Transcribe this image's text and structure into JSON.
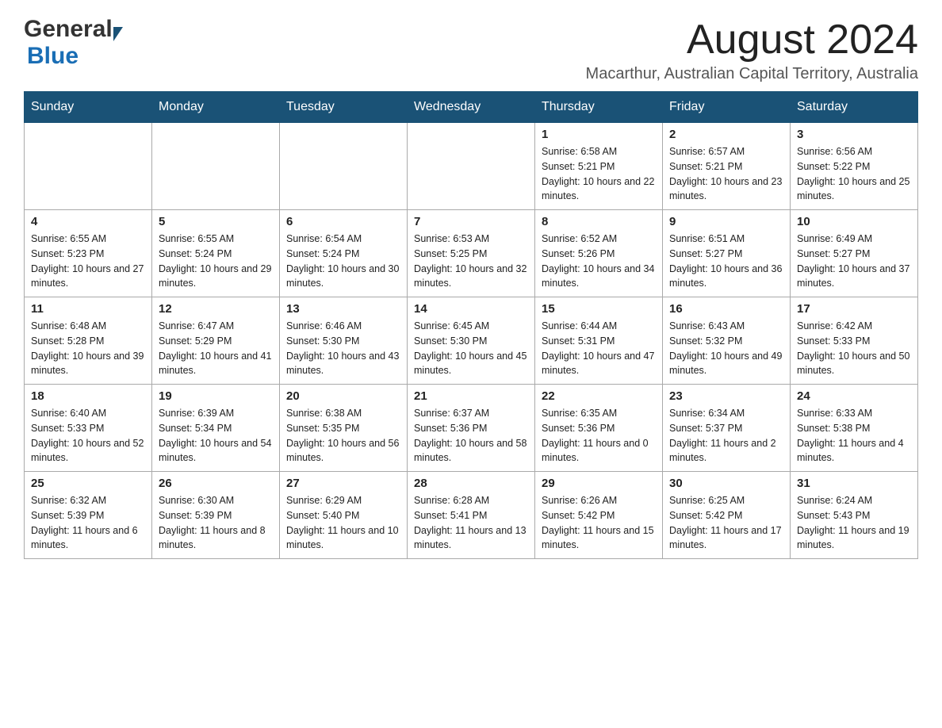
{
  "logo": {
    "general": "General",
    "blue": "Blue"
  },
  "title": "August 2024",
  "subtitle": "Macarthur, Australian Capital Territory, Australia",
  "headers": [
    "Sunday",
    "Monday",
    "Tuesday",
    "Wednesday",
    "Thursday",
    "Friday",
    "Saturday"
  ],
  "weeks": [
    [
      {
        "day": "",
        "info": ""
      },
      {
        "day": "",
        "info": ""
      },
      {
        "day": "",
        "info": ""
      },
      {
        "day": "",
        "info": ""
      },
      {
        "day": "1",
        "info": "Sunrise: 6:58 AM\nSunset: 5:21 PM\nDaylight: 10 hours and 22 minutes."
      },
      {
        "day": "2",
        "info": "Sunrise: 6:57 AM\nSunset: 5:21 PM\nDaylight: 10 hours and 23 minutes."
      },
      {
        "day": "3",
        "info": "Sunrise: 6:56 AM\nSunset: 5:22 PM\nDaylight: 10 hours and 25 minutes."
      }
    ],
    [
      {
        "day": "4",
        "info": "Sunrise: 6:55 AM\nSunset: 5:23 PM\nDaylight: 10 hours and 27 minutes."
      },
      {
        "day": "5",
        "info": "Sunrise: 6:55 AM\nSunset: 5:24 PM\nDaylight: 10 hours and 29 minutes."
      },
      {
        "day": "6",
        "info": "Sunrise: 6:54 AM\nSunset: 5:24 PM\nDaylight: 10 hours and 30 minutes."
      },
      {
        "day": "7",
        "info": "Sunrise: 6:53 AM\nSunset: 5:25 PM\nDaylight: 10 hours and 32 minutes."
      },
      {
        "day": "8",
        "info": "Sunrise: 6:52 AM\nSunset: 5:26 PM\nDaylight: 10 hours and 34 minutes."
      },
      {
        "day": "9",
        "info": "Sunrise: 6:51 AM\nSunset: 5:27 PM\nDaylight: 10 hours and 36 minutes."
      },
      {
        "day": "10",
        "info": "Sunrise: 6:49 AM\nSunset: 5:27 PM\nDaylight: 10 hours and 37 minutes."
      }
    ],
    [
      {
        "day": "11",
        "info": "Sunrise: 6:48 AM\nSunset: 5:28 PM\nDaylight: 10 hours and 39 minutes."
      },
      {
        "day": "12",
        "info": "Sunrise: 6:47 AM\nSunset: 5:29 PM\nDaylight: 10 hours and 41 minutes."
      },
      {
        "day": "13",
        "info": "Sunrise: 6:46 AM\nSunset: 5:30 PM\nDaylight: 10 hours and 43 minutes."
      },
      {
        "day": "14",
        "info": "Sunrise: 6:45 AM\nSunset: 5:30 PM\nDaylight: 10 hours and 45 minutes."
      },
      {
        "day": "15",
        "info": "Sunrise: 6:44 AM\nSunset: 5:31 PM\nDaylight: 10 hours and 47 minutes."
      },
      {
        "day": "16",
        "info": "Sunrise: 6:43 AM\nSunset: 5:32 PM\nDaylight: 10 hours and 49 minutes."
      },
      {
        "day": "17",
        "info": "Sunrise: 6:42 AM\nSunset: 5:33 PM\nDaylight: 10 hours and 50 minutes."
      }
    ],
    [
      {
        "day": "18",
        "info": "Sunrise: 6:40 AM\nSunset: 5:33 PM\nDaylight: 10 hours and 52 minutes."
      },
      {
        "day": "19",
        "info": "Sunrise: 6:39 AM\nSunset: 5:34 PM\nDaylight: 10 hours and 54 minutes."
      },
      {
        "day": "20",
        "info": "Sunrise: 6:38 AM\nSunset: 5:35 PM\nDaylight: 10 hours and 56 minutes."
      },
      {
        "day": "21",
        "info": "Sunrise: 6:37 AM\nSunset: 5:36 PM\nDaylight: 10 hours and 58 minutes."
      },
      {
        "day": "22",
        "info": "Sunrise: 6:35 AM\nSunset: 5:36 PM\nDaylight: 11 hours and 0 minutes."
      },
      {
        "day": "23",
        "info": "Sunrise: 6:34 AM\nSunset: 5:37 PM\nDaylight: 11 hours and 2 minutes."
      },
      {
        "day": "24",
        "info": "Sunrise: 6:33 AM\nSunset: 5:38 PM\nDaylight: 11 hours and 4 minutes."
      }
    ],
    [
      {
        "day": "25",
        "info": "Sunrise: 6:32 AM\nSunset: 5:39 PM\nDaylight: 11 hours and 6 minutes."
      },
      {
        "day": "26",
        "info": "Sunrise: 6:30 AM\nSunset: 5:39 PM\nDaylight: 11 hours and 8 minutes."
      },
      {
        "day": "27",
        "info": "Sunrise: 6:29 AM\nSunset: 5:40 PM\nDaylight: 11 hours and 10 minutes."
      },
      {
        "day": "28",
        "info": "Sunrise: 6:28 AM\nSunset: 5:41 PM\nDaylight: 11 hours and 13 minutes."
      },
      {
        "day": "29",
        "info": "Sunrise: 6:26 AM\nSunset: 5:42 PM\nDaylight: 11 hours and 15 minutes."
      },
      {
        "day": "30",
        "info": "Sunrise: 6:25 AM\nSunset: 5:42 PM\nDaylight: 11 hours and 17 minutes."
      },
      {
        "day": "31",
        "info": "Sunrise: 6:24 AM\nSunset: 5:43 PM\nDaylight: 11 hours and 19 minutes."
      }
    ]
  ]
}
